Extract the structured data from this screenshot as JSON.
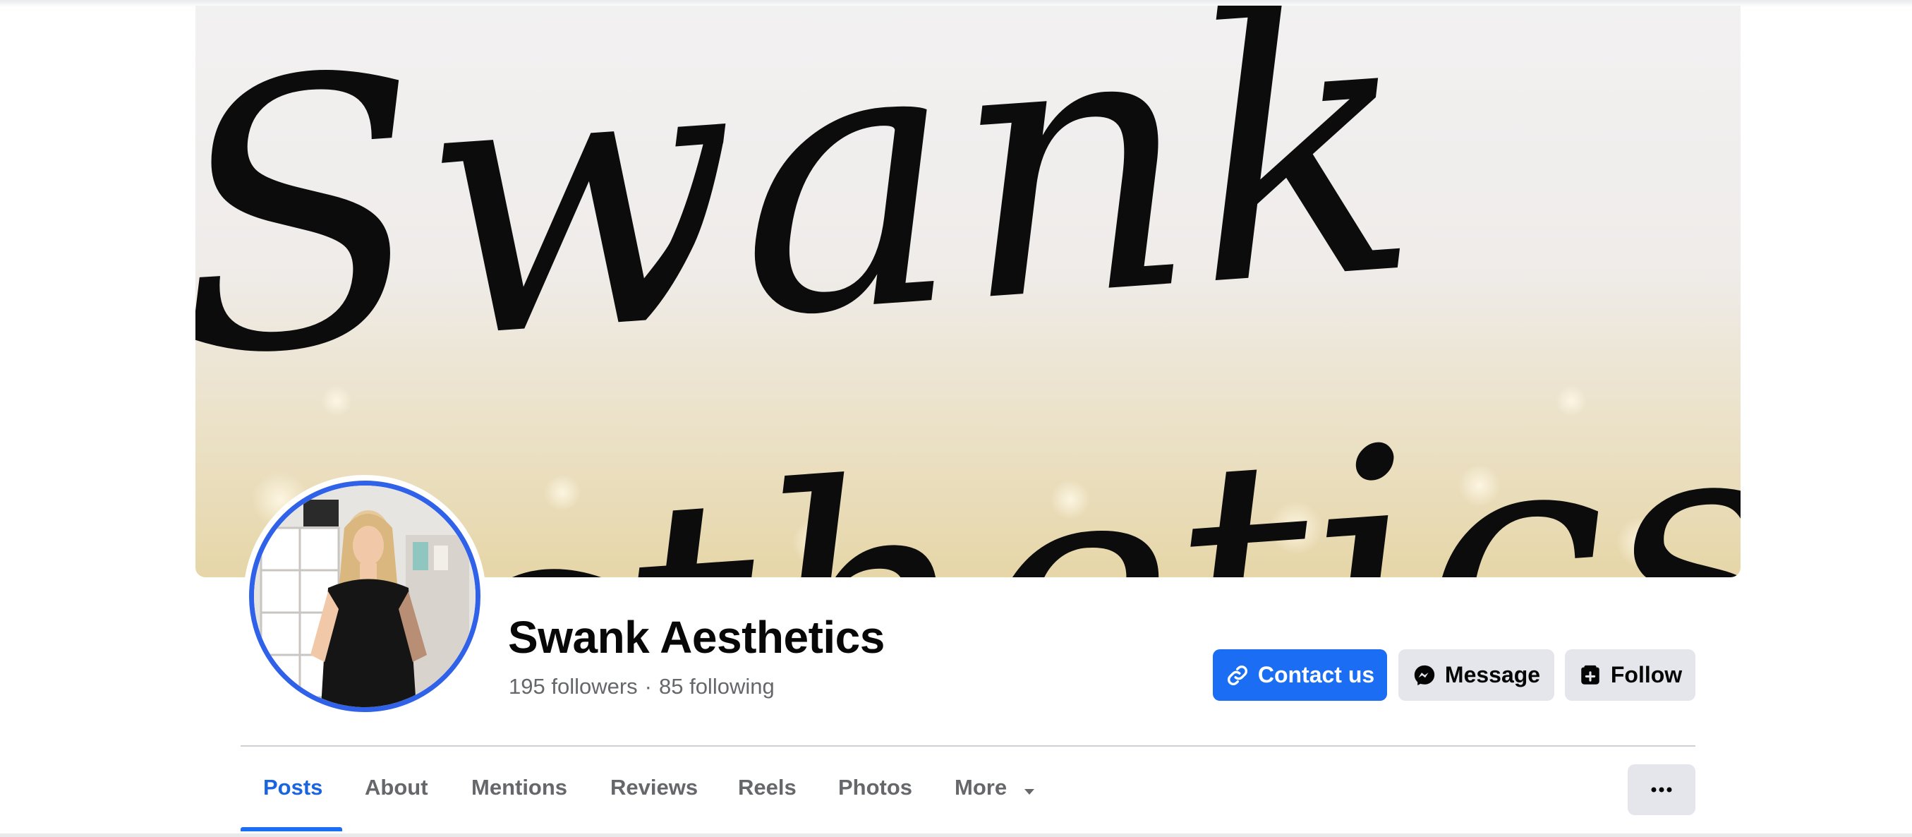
{
  "cover": {
    "text_line1": "Swank",
    "text_line2": "Aesthetics"
  },
  "profile": {
    "name": "Swank Aesthetics",
    "followers": "195 followers",
    "separator": "·",
    "following": "85 following",
    "ring_color": "#2f62e8"
  },
  "actions": {
    "contact_label": "Contact us",
    "message_label": "Message",
    "follow_label": "Follow",
    "primary_color": "#1b6ef3",
    "secondary_color": "#e4e6eb"
  },
  "tabs": [
    {
      "label": "Posts",
      "active": true
    },
    {
      "label": "About",
      "active": false
    },
    {
      "label": "Mentions",
      "active": false
    },
    {
      "label": "Reviews",
      "active": false
    },
    {
      "label": "Reels",
      "active": false
    },
    {
      "label": "Photos",
      "active": false
    },
    {
      "label": "More",
      "active": false
    }
  ],
  "icons": {
    "contact": "link-icon",
    "message": "messenger-icon",
    "follow": "follow-icon",
    "more": "caret-down-icon",
    "overflow": "ellipsis-icon"
  }
}
